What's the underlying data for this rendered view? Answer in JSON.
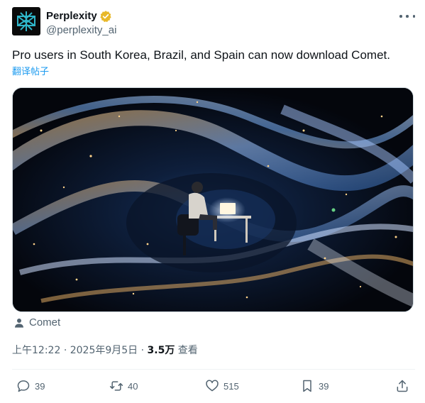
{
  "author": {
    "display_name": "Perplexity",
    "handle": "@perplexity_ai",
    "avatar_icon": "perplexity-logo-icon",
    "verified_icon": "gold-verified-badge-icon"
  },
  "post": {
    "text": "Pro users in South Korea, Brazil, and Spain can now download Comet.",
    "translate_label": "翻译帖子",
    "media_icon": "image-cosmic-vortex-person-at-laptop",
    "source_label": "Comet",
    "time": "上午12:22",
    "separator": "·",
    "date": "2025年9月5日",
    "views": "3.5万",
    "views_label": "查看"
  },
  "actions": {
    "replies": "39",
    "reposts": "40",
    "likes": "515",
    "bookmarks": "39"
  },
  "colors": {
    "text_primary": "#0f1419",
    "text_secondary": "#536471",
    "link": "#1d9bf0",
    "verified_gold": "#e8b829",
    "divider": "#eff3f4"
  }
}
